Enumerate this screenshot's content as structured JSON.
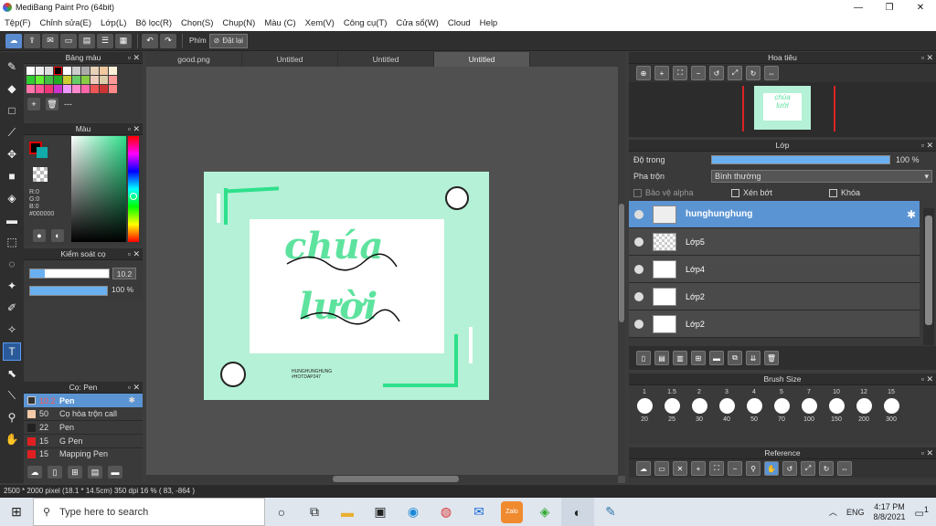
{
  "window": {
    "title": "MediBang Paint Pro (64bit)",
    "controls": [
      "—",
      "❐",
      "✕"
    ]
  },
  "menu": [
    "Tệp(F)",
    "Chỉnh sửa(E)",
    "Lớp(L)",
    "Bộ lọc(R)",
    "Chọn(S)",
    "Chụp(N)",
    "Màu (C)",
    "Xem(V)",
    "Công cụ(T)",
    "Cửa sổ(W)",
    "Cloud",
    "Help"
  ],
  "toolbar": {
    "phim_label": "Phím",
    "reset_label": "Đặt lại"
  },
  "panels": {
    "palette": {
      "title": "Bảng màu",
      "footer": "---"
    },
    "color": {
      "title": "Màu",
      "r": "R:0",
      "g": "G:0",
      "b": "B:0",
      "hex": "#000000"
    },
    "brush_control": {
      "title": "Kiểm soát cọ",
      "size": "10.2",
      "opacity": "100 %"
    },
    "brushes": {
      "title": "Cọ: Pen",
      "items": [
        {
          "size": "10.2",
          "name": "Pen",
          "color": "#333333"
        },
        {
          "size": "50",
          "name": "Cọ hòa trộn call",
          "color": "#f4c9a8"
        },
        {
          "size": "22",
          "name": "Pen",
          "color": "#222222"
        },
        {
          "size": "15",
          "name": "G Pen",
          "color": "#e02020"
        },
        {
          "size": "15",
          "name": "Mapping Pen",
          "color": "#e02020"
        }
      ]
    },
    "navigator": {
      "title": "Hoa tiêu"
    },
    "layers": {
      "title": "Lớp",
      "opacity_label": "Độ trong",
      "opacity_value": "100 %",
      "blend_label": "Pha trộn",
      "blend_value": "Bình thường",
      "protect_alpha": "Bảo vệ alpha",
      "clipping": "Xén bớt",
      "lock": "Khóa",
      "items": [
        "hunghunghung",
        "Lớp5",
        "Lớp4",
        "Lớp2",
        "Lớp2"
      ]
    },
    "brush_size": {
      "title": "Brush Size",
      "row1": [
        "1",
        "1.5",
        "2",
        "3",
        "4",
        "5",
        "7",
        "10",
        "12",
        "15"
      ],
      "row2": [
        "20",
        "25",
        "30",
        "40",
        "50",
        "70",
        "100",
        "150",
        "200",
        "300"
      ]
    },
    "reference": {
      "title": "Reference"
    }
  },
  "tabs": [
    "good.png",
    "Untitled",
    "Untitled",
    "Untitled"
  ],
  "canvas": {
    "line1": "chúa",
    "line2": "lười",
    "caption1": "HUNGHUNGHUNG",
    "caption2": "#HOTDAP247"
  },
  "status": "2500 * 2000 pixel   (18.1 * 14.5cm)   350 dpi   16 %   ( 83, -864 )",
  "taskbar": {
    "search_placeholder": "Type here to search",
    "lang": "ENG",
    "time": "4:17 PM",
    "date": "8/8/2021",
    "notifications": "1"
  },
  "colors": {
    "accent": "#5b94d3",
    "canvas_bg": "#b4f1d6",
    "brand_green": "#2ee08b"
  }
}
